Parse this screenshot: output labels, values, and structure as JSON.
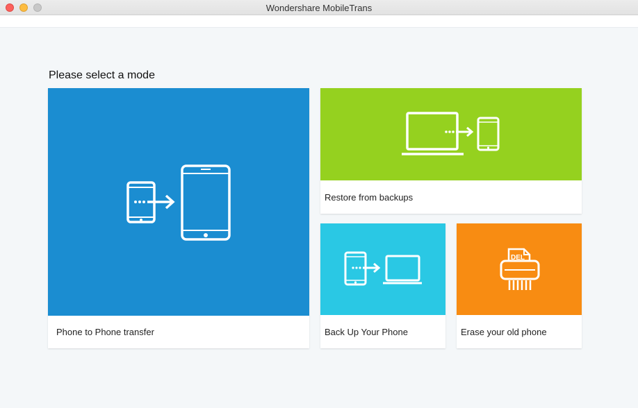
{
  "window": {
    "title": "Wondershare MobileTrans"
  },
  "main": {
    "heading": "Please select a mode"
  },
  "modes": [
    {
      "label": "Phone to Phone transfer",
      "color": "#1b8dd1",
      "icon": "phone-to-phone-icon"
    },
    {
      "label": "Restore from backups",
      "color": "#95d11f",
      "icon": "laptop-to-phone-icon"
    },
    {
      "label": "Back Up Your Phone",
      "color": "#2ac8e4",
      "icon": "phone-to-laptop-icon"
    },
    {
      "label": "Erase your old phone",
      "color": "#f88c12",
      "icon": "shredder-icon",
      "icon_text": "DEL"
    }
  ]
}
